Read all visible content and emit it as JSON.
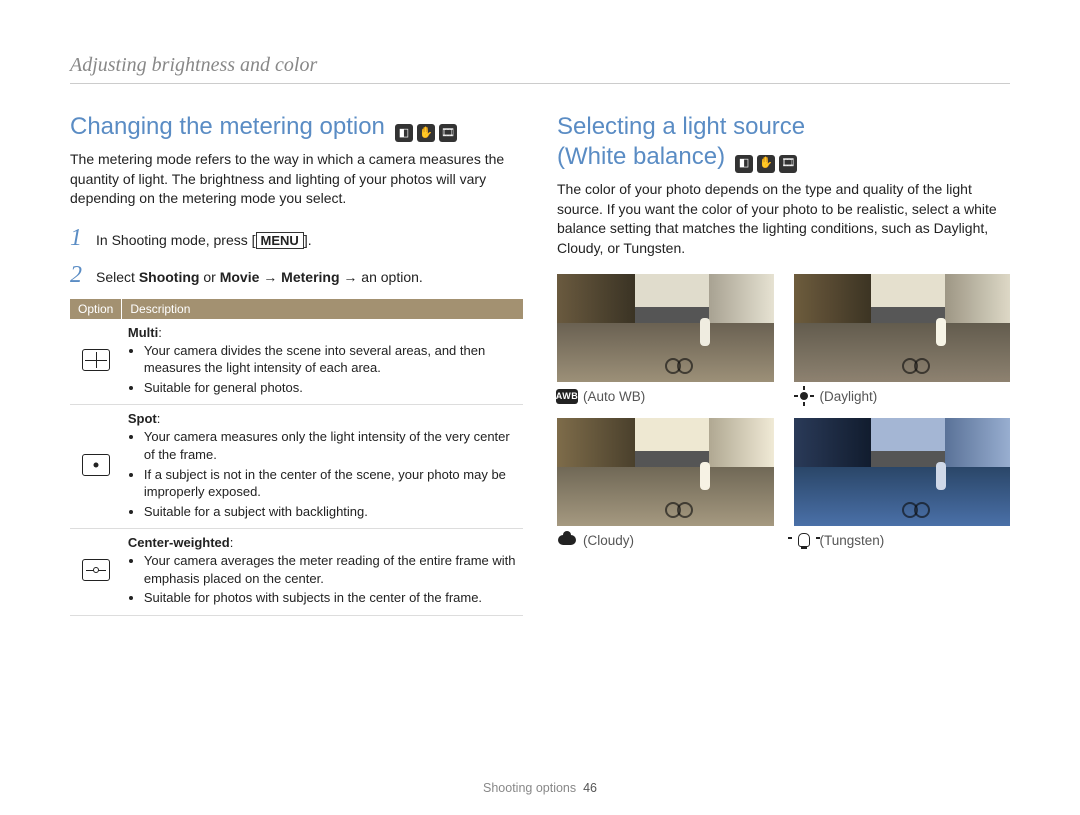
{
  "chapter": "Adjusting brightness and color",
  "left": {
    "title": "Changing the metering option",
    "mode_icons": [
      "camera-p-icon",
      "hand-icon",
      "film-icon"
    ],
    "intro": "The metering mode refers to the way in which a camera measures the quantity of light. The brightness and lighting of your photos will vary depending on the metering mode you select.",
    "steps": [
      {
        "num": "1",
        "pre": "In Shooting mode, press [",
        "key": "MENU",
        "post": "]."
      },
      {
        "num": "2",
        "pre": "Select ",
        "b1": "Shooting",
        "mid1": " or ",
        "b2": "Movie",
        "mid2": " → ",
        "b3": "Metering",
        "post": " → an option."
      }
    ],
    "table": {
      "headers": [
        "Option",
        "Description"
      ],
      "rows": [
        {
          "icon": "metering-multi-icon",
          "name": "Multi",
          "bullets": [
            "Your camera divides the scene into several areas, and then measures the light intensity of each area.",
            "Suitable for general photos."
          ]
        },
        {
          "icon": "metering-spot-icon",
          "name": "Spot",
          "bullets": [
            "Your camera measures only the light intensity of the very center of the frame.",
            "If a subject is not in the center of the scene, your photo may be improperly exposed.",
            "Suitable for a subject with backlighting."
          ]
        },
        {
          "icon": "metering-center-icon",
          "name": "Center-weighted",
          "bullets": [
            "Your camera averages the meter reading of the entire frame with emphasis placed on the center.",
            "Suitable for photos with subjects in the center of the frame."
          ]
        }
      ]
    }
  },
  "right": {
    "title_l1": "Selecting a light source",
    "title_l2": "(White balance)",
    "mode_icons": [
      "camera-p-icon",
      "hand-icon",
      "film-icon"
    ],
    "intro": "The color of your photo depends on the type and quality of the light source. If you want the color of your photo to be realistic, select a white balance setting that matches the lighting conditions, such as Daylight, Cloudy, or Tungsten.",
    "samples": [
      {
        "icon": "auto-wb-icon",
        "label": " (Auto WB)",
        "variant": "wb-auto"
      },
      {
        "icon": "daylight-icon",
        "label": " (Daylight)",
        "variant": "wb-daylight"
      },
      {
        "icon": "cloudy-icon",
        "label": " (Cloudy)",
        "variant": "wb-cloudy"
      },
      {
        "icon": "tungsten-icon",
        "label": " (Tungsten)",
        "variant": "wb-tungsten"
      }
    ]
  },
  "footer": {
    "section": "Shooting options",
    "page": "46"
  }
}
